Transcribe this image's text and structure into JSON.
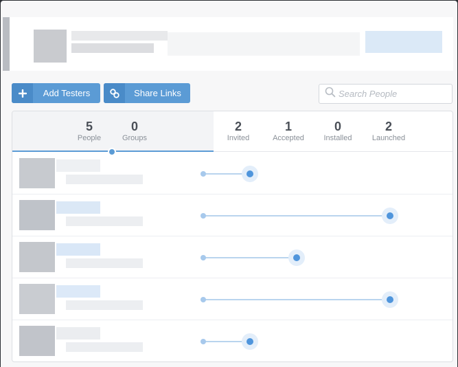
{
  "toolbar": {
    "add_label": "Add Testers",
    "share_label": "Share Links",
    "search_placeholder": "Search People"
  },
  "stats": [
    {
      "key": "people",
      "value": "5",
      "label": "People"
    },
    {
      "key": "groups",
      "value": "0",
      "label": "Groups"
    },
    {
      "key": "invited",
      "value": "2",
      "label": "Invited"
    },
    {
      "key": "accepted",
      "value": "1",
      "label": "Accepted"
    },
    {
      "key": "installed",
      "value": "0",
      "label": "Installed"
    },
    {
      "key": "launched",
      "value": "2",
      "label": "Launched"
    }
  ],
  "testers": [
    {
      "progress_stage": 1
    },
    {
      "progress_stage": 4
    },
    {
      "progress_stage": 2
    },
    {
      "progress_stage": 4
    },
    {
      "progress_stage": 1
    }
  ],
  "progress_stages_max": 4,
  "colors": {
    "accent": "#5b9bd5",
    "track": "#b9d4ee",
    "knob": "#4f95dc"
  }
}
